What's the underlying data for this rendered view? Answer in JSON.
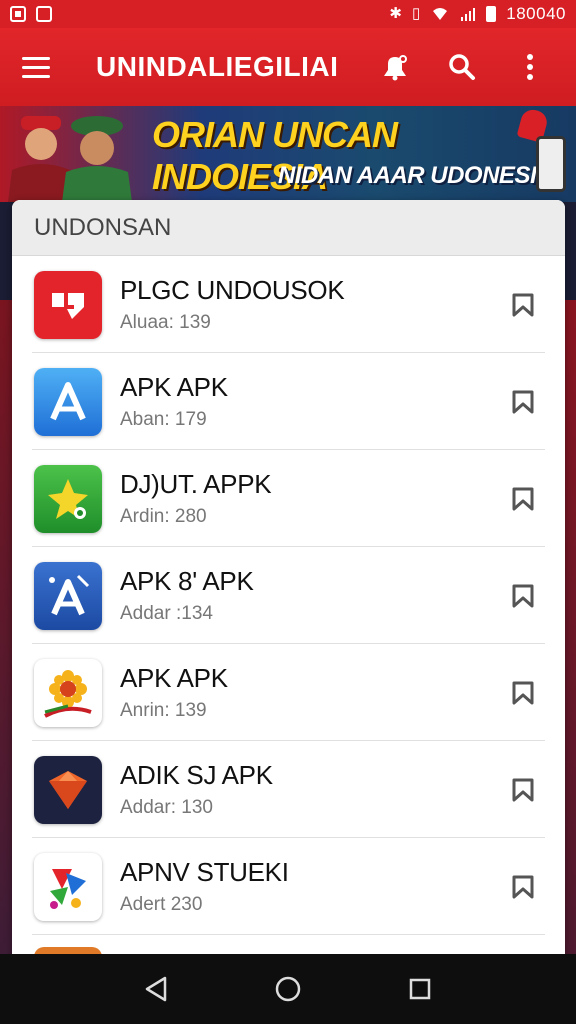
{
  "status_bar": {
    "time": "180040",
    "icons": [
      "notification-icon",
      "gallery-icon",
      "bluetooth-icon",
      "vibrate-icon",
      "wifi-icon",
      "signal-icon",
      "battery-icon"
    ]
  },
  "app_bar": {
    "title": "UNINDALIEGILIAI",
    "icons": [
      "menu-icon",
      "bell-icon",
      "search-icon",
      "more-vert-icon"
    ]
  },
  "banner": {
    "title": "ORIAN UNCAN INDOIESIA",
    "subtitle": "NIDAN AAAR UDONESIC"
  },
  "list": {
    "header": "UNDONSAN",
    "items": [
      {
        "name": "PLGC UNDOUSOK",
        "meta": "Aluaa: 139",
        "icon": "red-download-icon",
        "color": "#e3242b"
      },
      {
        "name": "APK APK",
        "meta": "Aban: 179",
        "icon": "blue-a-icon",
        "color": "#2a8be6"
      },
      {
        "name": "DJ)UT. APPK",
        "meta": "Ardin: 280",
        "icon": "green-star-icon",
        "color": "#31a83a"
      },
      {
        "name": "APK 8' APK",
        "meta": "Addar :134",
        "icon": "blue-a-tools-icon",
        "color": "#2358b8"
      },
      {
        "name": "APK APK",
        "meta": "Anrin: 139",
        "icon": "sunflower-icon",
        "color": "#ffffff"
      },
      {
        "name": "ADIK SJ APK",
        "meta": "Addar: 130",
        "icon": "orange-gem-icon",
        "color": "#1c2240"
      },
      {
        "name": "APNV STUEKI",
        "meta": "Adert 230",
        "icon": "colorful-shapes-icon",
        "color": "#ffffff"
      }
    ]
  },
  "nav_bar": {
    "icons": [
      "back-icon",
      "home-icon",
      "recents-icon"
    ]
  }
}
